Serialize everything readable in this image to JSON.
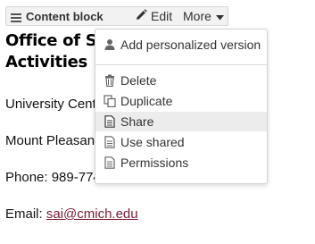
{
  "toolbar": {
    "title": "Content block",
    "edit_label": "Edit",
    "more_label": "More"
  },
  "content": {
    "heading_line1": "Office of S",
    "heading_line2": "Activities",
    "address1": "University Cent",
    "address2": "Mount Pleasan",
    "phone": "Phone: 989-774",
    "email_prefix": "Email: ",
    "email": "sai@cmich.edu"
  },
  "menu": {
    "items": [
      {
        "label": "Add personalized version",
        "icon": "user-icon"
      },
      {
        "label": "Delete",
        "icon": "trash-icon"
      },
      {
        "label": "Duplicate",
        "icon": "duplicate-icon"
      },
      {
        "label": "Share",
        "icon": "document-icon"
      },
      {
        "label": "Use shared",
        "icon": "document-icon"
      },
      {
        "label": "Permissions",
        "icon": "document-icon"
      }
    ],
    "active_item": "Share"
  }
}
